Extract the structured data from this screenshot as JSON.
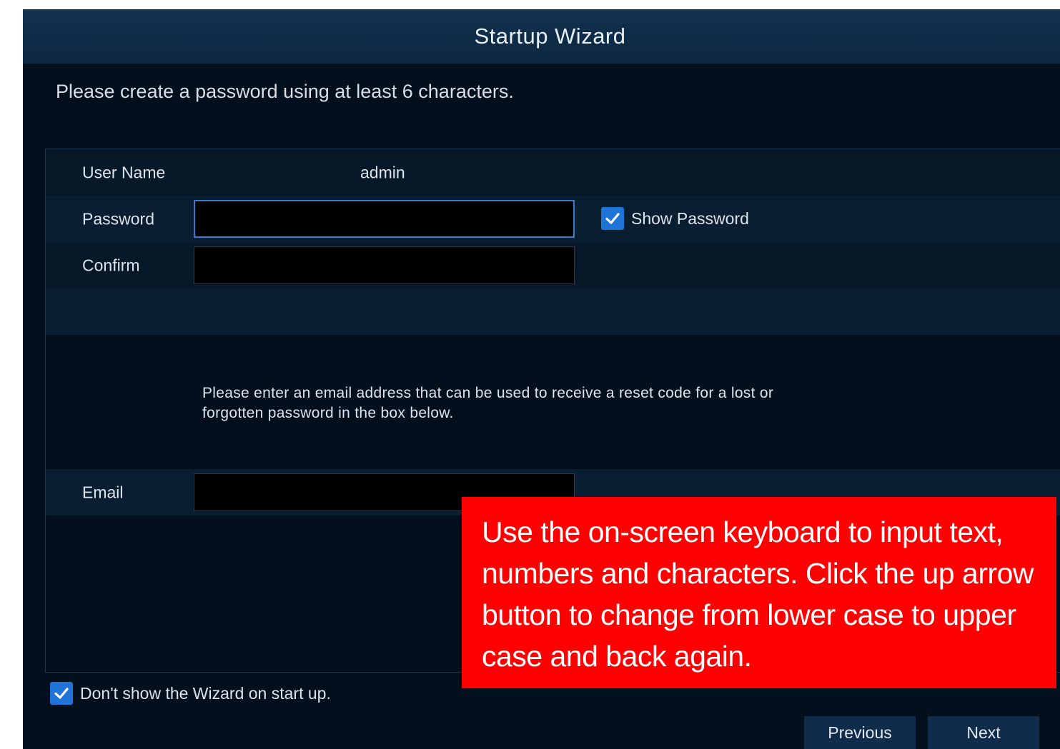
{
  "window": {
    "title": "Startup Wizard"
  },
  "instruction": "Please create a password using at least 6 characters.",
  "form": {
    "username_label": "User Name",
    "username_value": "admin",
    "password_label": "Password",
    "password_value": "",
    "show_password_label": "Show Password",
    "show_password_checked": true,
    "confirm_label": "Confirm",
    "confirm_value": "",
    "email_note": "Please enter an email address that can be used to receive a reset code for a lost or forgotten password in the box below.",
    "email_label": "Email",
    "email_value": ""
  },
  "footer": {
    "dont_show_label": "Don't show the Wizard on start up.",
    "dont_show_checked": true,
    "previous_label": "Previous",
    "next_label": "Next"
  },
  "callout": {
    "text": "Use the on-screen keyboard to input text, numbers and characters. Click the up arrow button to change from lower case to upper case and back again."
  },
  "colors": {
    "background": "#02101e",
    "titlebar": "#12324f",
    "accent": "#1f74d8",
    "callout": "#ff0000"
  }
}
